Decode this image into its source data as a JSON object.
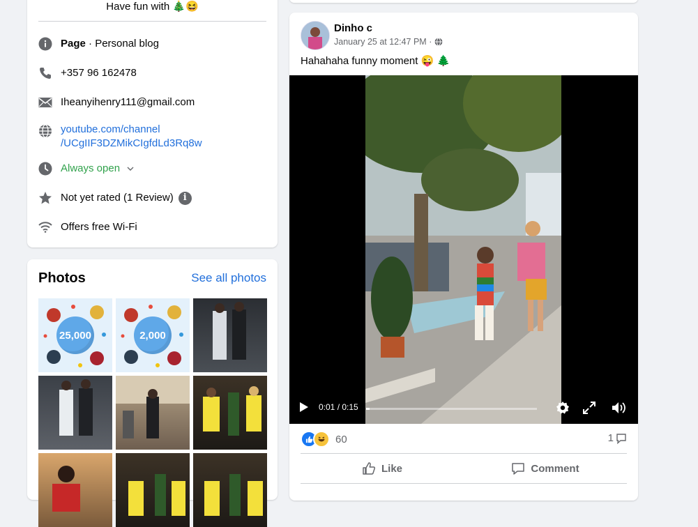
{
  "intro": {
    "tagline": "Have fun with 🎄😆",
    "rows": {
      "page_bold": "Page",
      "page_rest": " · Personal blog",
      "phone": "+357 96 162478",
      "email": "Iheanyihenry111@gmail.com",
      "website_line1": "youtube.com/channel",
      "website_line2": "/UCgIIF3DZMikCIgfdLd3Rq8w",
      "hours": "Always open",
      "rating": "Not yet rated (1 Review)",
      "wifi": "Offers free Wi-Fi"
    }
  },
  "photos": {
    "title": "Photos",
    "see_all": "See all photos",
    "milestone_1": "25,000",
    "milestone_2": "2,000"
  },
  "post": {
    "author": "Dinho c",
    "timestamp": "January 25 at 12:47 PM · ",
    "text": "Hahahaha funny moment 😜 🌲",
    "video_time": "0:01 / 0:15",
    "video_progress": 0.02,
    "reaction_count": "60",
    "comment_count": "1",
    "like_label": "Like",
    "comment_label": "Comment"
  },
  "colors": {
    "link": "#216fdb",
    "open_status": "#31a24c",
    "background": "#f0f2f5"
  },
  "icons": [
    "info-icon",
    "phone-icon",
    "email-icon",
    "globe-icon",
    "clock-icon",
    "chevron-down-icon",
    "star-icon",
    "wifi-icon",
    "globe-privacy-icon",
    "play-icon",
    "settings-icon",
    "fullscreen-icon",
    "volume-icon",
    "like-icon",
    "comment-icon"
  ]
}
